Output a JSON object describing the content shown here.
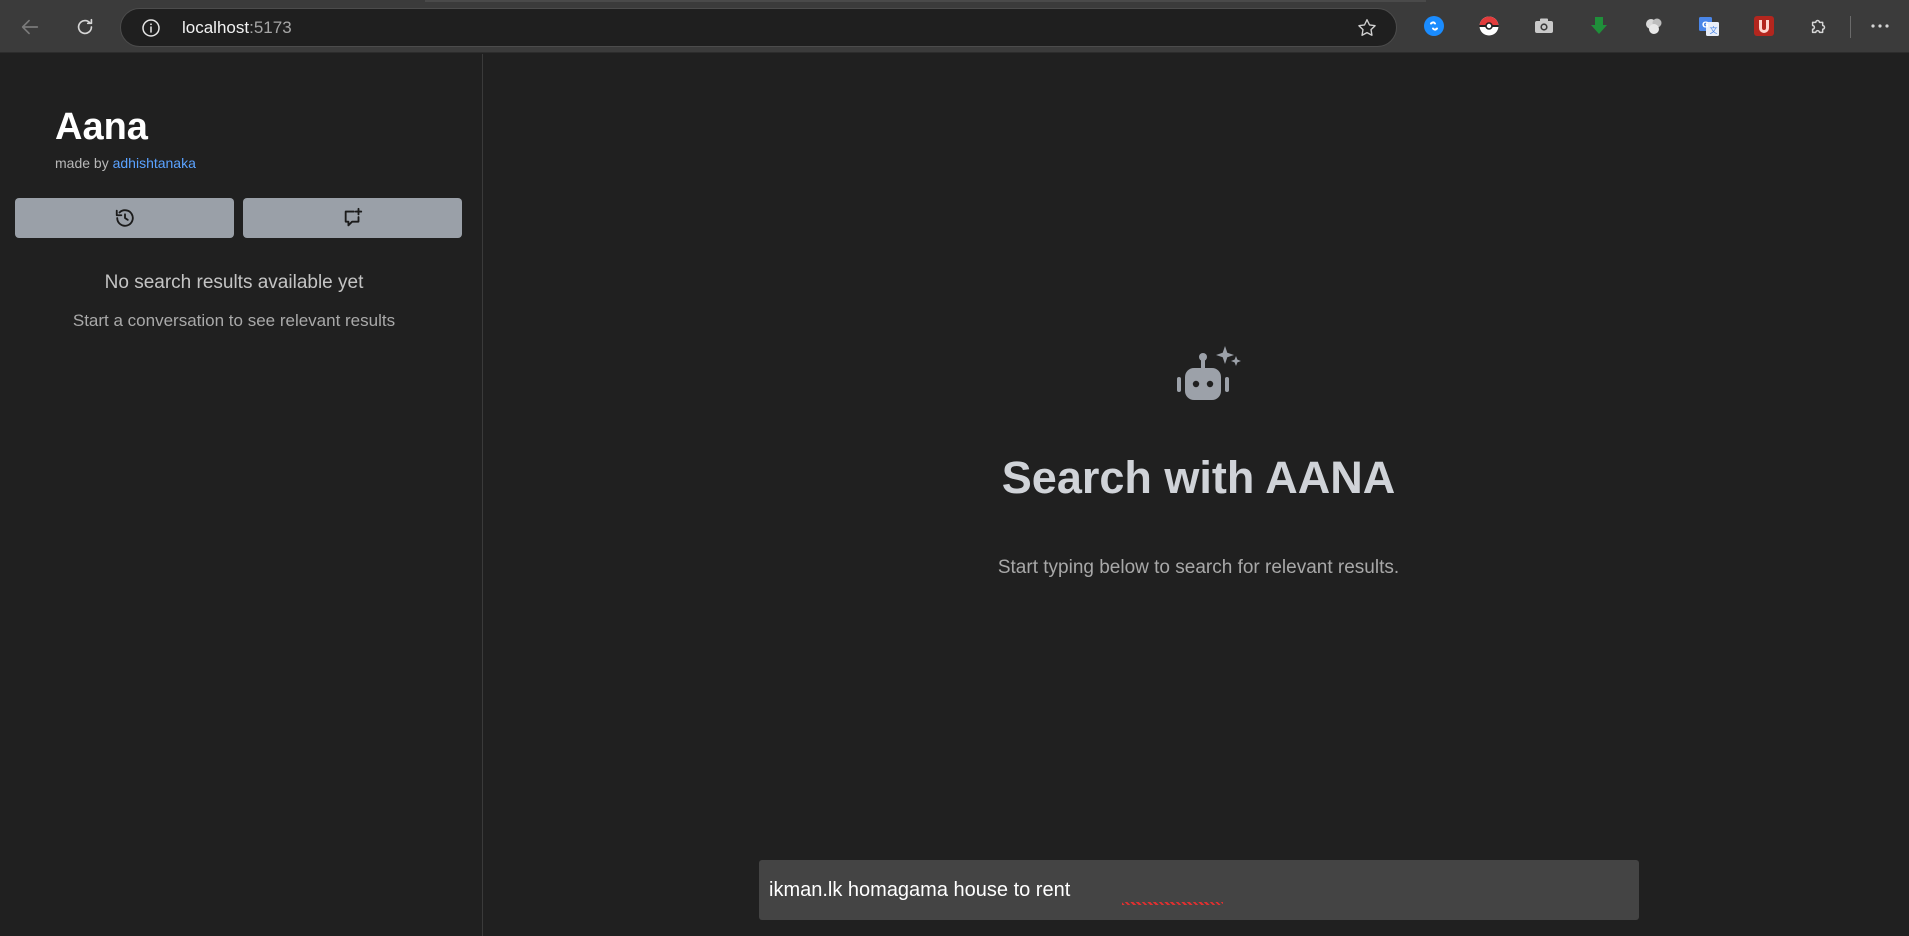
{
  "browser": {
    "url_host": "localhost",
    "url_port": ":5173",
    "back_icon": "arrow-left-icon",
    "reload_icon": "reload-icon",
    "site_info_icon": "info-icon",
    "favorite_icon": "star-icon",
    "extensions": [
      "shazam-icon",
      "pokeball-icon",
      "camera-icon",
      "download-icon",
      "cloud-icon",
      "translate-icon",
      "ublock-icon",
      "puzzle-icon"
    ],
    "menu_icon": "more-icon"
  },
  "sidebar": {
    "brand": "Aana",
    "byline_prefix": "made by ",
    "byline_author": "adhishtanaka",
    "history_button_icon": "history-icon",
    "new_chat_button_icon": "new-chat-icon",
    "empty_title": "No search results available yet",
    "empty_subtitle": "Start a conversation to see relevant results"
  },
  "main": {
    "hero_icon": "robot-sparkle-icon",
    "title": "Search with AANA",
    "subtitle": "Start typing below to search for relevant results.",
    "search_value": "ikman.lk homagama house to rent"
  },
  "colors": {
    "background": "#202020",
    "toolbar": "#3b3b3b",
    "link": "#5aa2ff",
    "button": "#9aa0a8",
    "input": "#444444"
  }
}
